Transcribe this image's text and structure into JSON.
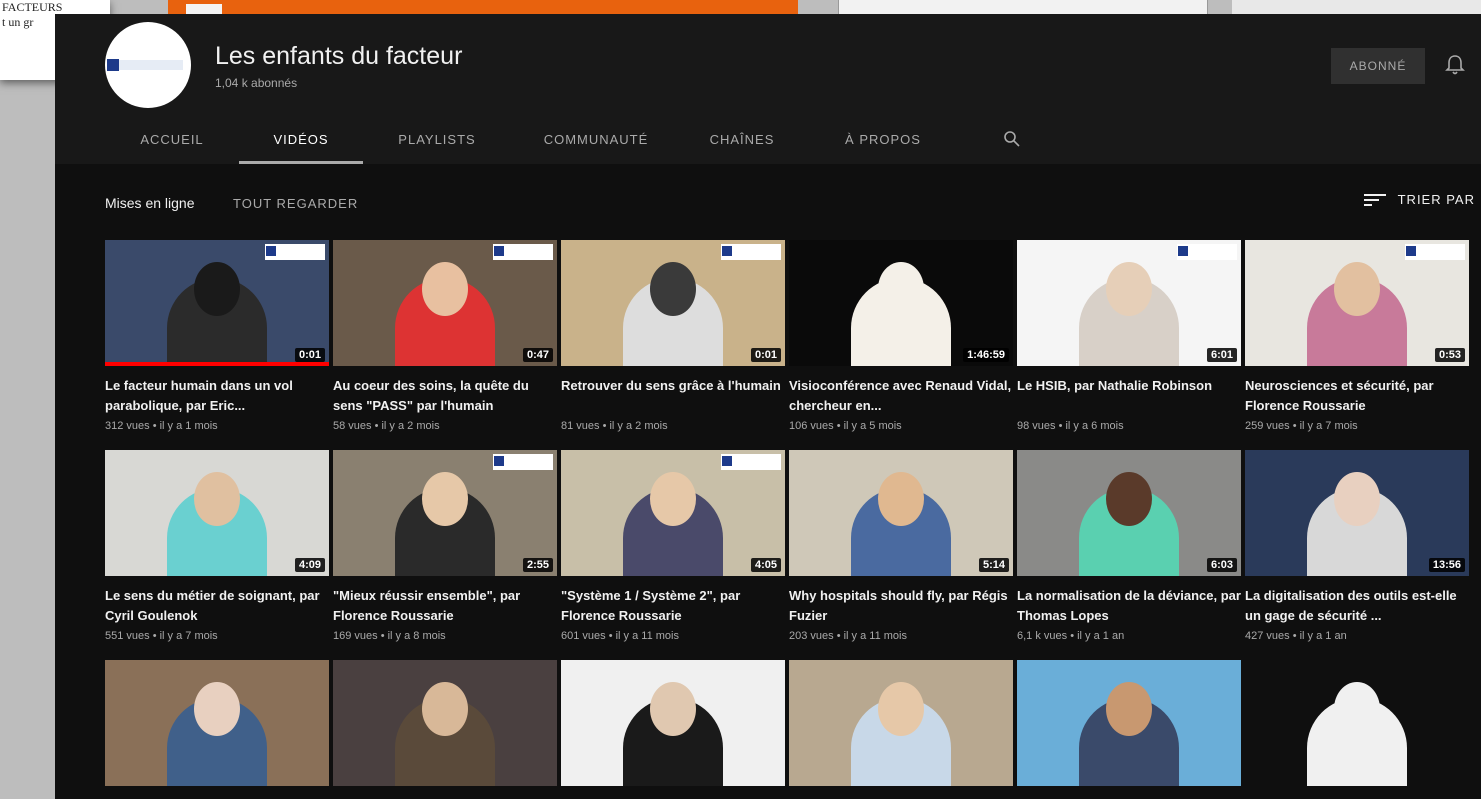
{
  "background": {
    "doc_line1": "FACTEURS",
    "doc_line2": "t un gr"
  },
  "channel": {
    "name": "Les enfants du facteur",
    "subscribers": "1,04 k abonnés",
    "subscribe_label": "ABONNÉ"
  },
  "tabs": [
    "ACCUEIL",
    "VIDÉOS",
    "PLAYLISTS",
    "COMMUNAUTÉ",
    "CHAÎNES",
    "À PROPOS"
  ],
  "active_tab": "VIDÉOS",
  "toolbar": {
    "uploads_label": "Mises en ligne",
    "play_all": "TOUT REGARDER",
    "sort_label": "TRIER PAR"
  },
  "videos": [
    {
      "title": "Le facteur humain dans un vol parabolique, par Eric...",
      "meta": "312 vues • il y a 1 mois",
      "duration": "0:01",
      "watched": 1.0
    },
    {
      "title": "Au coeur des soins, la quête du sens \"PASS\" par l'humain",
      "meta": "58 vues • il y a 2 mois",
      "duration": "0:47"
    },
    {
      "title": "Retrouver du sens grâce à l'humain",
      "meta": "81 vues • il y a 2 mois",
      "duration": "0:01"
    },
    {
      "title": "Visioconférence avec Renaud Vidal, chercheur en...",
      "meta": "106 vues • il y a 5 mois",
      "duration": "1:46:59"
    },
    {
      "title": "Le HSIB, par Nathalie Robinson",
      "meta": "98 vues • il y a 6 mois",
      "duration": "6:01"
    },
    {
      "title": "Neurosciences et sécurité, par Florence Roussarie",
      "meta": "259 vues • il y a 7 mois",
      "duration": "0:53"
    },
    {
      "title": "Le sens du métier de soignant, par Cyril Goulenok",
      "meta": "551 vues • il y a 7 mois",
      "duration": "4:09"
    },
    {
      "title": "\"Mieux réussir ensemble\", par Florence Roussarie",
      "meta": "169 vues • il y a 8 mois",
      "duration": "2:55"
    },
    {
      "title": "\"Système 1 / Système 2\", par Florence Roussarie",
      "meta": "601 vues • il y a 11 mois",
      "duration": "4:05"
    },
    {
      "title": "Why hospitals should fly, par Régis Fuzier",
      "meta": "203 vues • il y a 11 mois",
      "duration": "5:14"
    },
    {
      "title": "La normalisation de la déviance, par Thomas Lopes",
      "meta": "6,1 k vues • il y a 1 an",
      "duration": "6:03"
    },
    {
      "title": "La digitalisation des outils est-elle un gage de sécurité ...",
      "meta": "427 vues • il y a 1 an",
      "duration": "13:56"
    },
    {
      "title": "",
      "meta": "",
      "duration": ""
    },
    {
      "title": "",
      "meta": "",
      "duration": ""
    },
    {
      "title": "",
      "meta": "",
      "duration": ""
    },
    {
      "title": "",
      "meta": "",
      "duration": ""
    },
    {
      "title": "",
      "meta": "",
      "duration": ""
    },
    {
      "title": "",
      "meta": "",
      "duration": ""
    }
  ]
}
